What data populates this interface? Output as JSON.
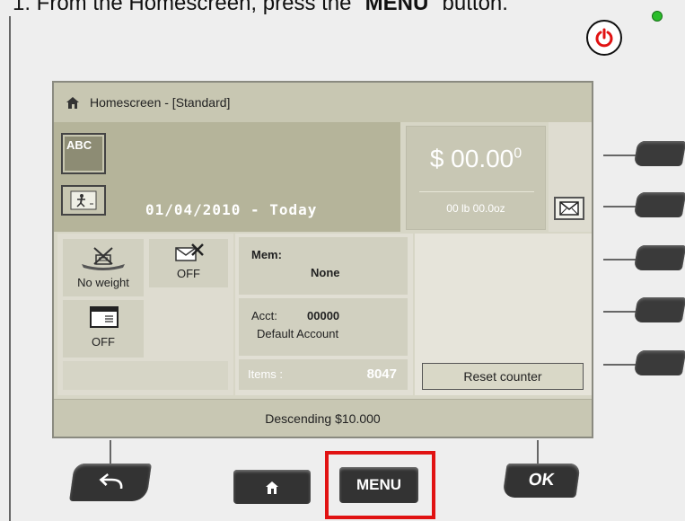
{
  "instruction": {
    "prefix": "1. From the Homescreen, press the \"",
    "key": "MENU",
    "suffix": "\" button."
  },
  "screen": {
    "title": "Homescreen - [Standard]",
    "abc_label": "ABC",
    "date": "01/04/2010 - Today",
    "postage_amount": "$ 00.00",
    "postage_superscript": "0",
    "weight": "00 lb 00.0oz",
    "scale_label": "No weight",
    "envelope_off_label": "OFF",
    "seal_off_label": "OFF",
    "mem_label": "Mem:",
    "mem_value": "None",
    "acct_label": "Acct:",
    "acct_value": "00000",
    "acct_name": "Default Account",
    "items_label": "Items :",
    "items_value": "8047",
    "reset_label": "Reset counter",
    "status": "Descending $10.000"
  },
  "hardware": {
    "menu_label": "MENU",
    "ok_label": "OK"
  },
  "colors": {
    "led": "#2bbd2b",
    "power": "#e11212",
    "highlight": "#e11212"
  }
}
